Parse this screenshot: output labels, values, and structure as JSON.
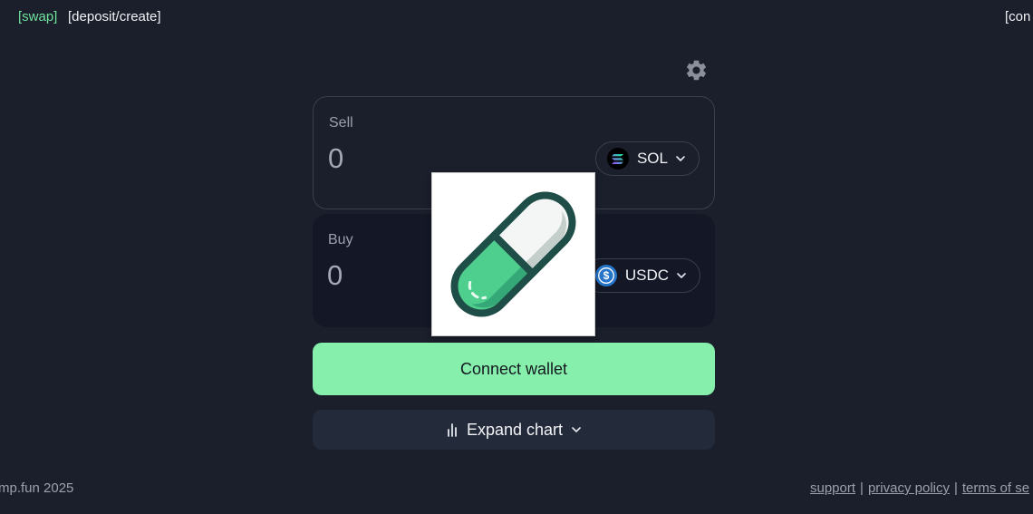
{
  "nav": {
    "swap_label": "[swap]",
    "deposit_label": "[deposit/create]",
    "connect_label": "[con"
  },
  "icons": {
    "settings": "gear-icon",
    "sol": "solana-icon",
    "usdc": "usdc-icon",
    "chevron": "chevron-down-icon",
    "chart": "bar-chart-icon",
    "overlay": "pill-capsule-image"
  },
  "sell": {
    "label": "Sell",
    "placeholder": "0",
    "token": "SOL"
  },
  "buy": {
    "label": "Buy",
    "placeholder": "0",
    "token": "USDC"
  },
  "actions": {
    "connect_label": "Connect wallet",
    "expand_label": "Expand chart"
  },
  "footer": {
    "copyright": "mp.fun 2025",
    "support": "support",
    "privacy": "privacy policy",
    "terms": "terms of se",
    "separator": "|"
  },
  "colors": {
    "background": "#1b1f2b",
    "accent_green": "#86efac",
    "nav_active": "#6fe39c",
    "usdc_blue": "#2775ca"
  }
}
